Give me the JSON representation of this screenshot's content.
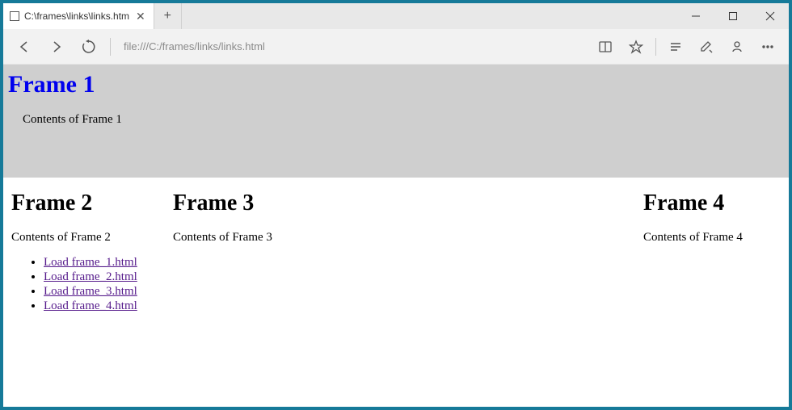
{
  "titlebar": {
    "tab_title": "C:\\frames\\links\\links.htm",
    "tab_close": "✕",
    "newtab": "+"
  },
  "toolbar": {
    "address": "file:///C:/frames/links/links.html"
  },
  "frames": {
    "f1": {
      "heading": "Frame 1",
      "body": "Contents of Frame 1"
    },
    "f2": {
      "heading": "Frame 2",
      "body": "Contents of Frame 2",
      "links": [
        "Load frame_1.html",
        "Load frame_2.html",
        "Load frame_3.html",
        "Load frame_4.html"
      ]
    },
    "f3": {
      "heading": "Frame 3",
      "body": "Contents of Frame 3"
    },
    "f4": {
      "heading": "Frame 4",
      "body": "Contents of Frame 4"
    }
  }
}
